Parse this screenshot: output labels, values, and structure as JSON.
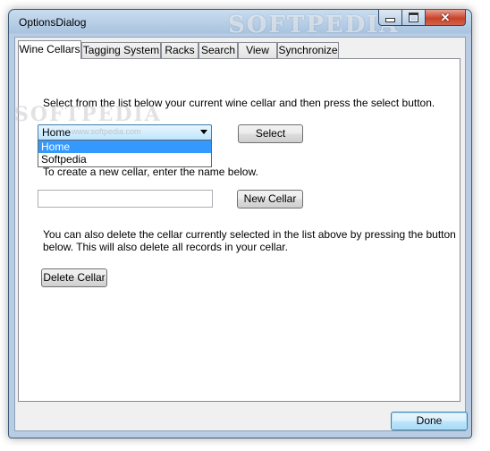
{
  "window": {
    "title": "OptionsDialog",
    "watermark": "SOFTPEDIA",
    "watermark_url": "www.softpedia.com"
  },
  "tabs": [
    {
      "label": "Wine Cellars",
      "active": true
    },
    {
      "label": "Tagging System",
      "active": false
    },
    {
      "label": "Racks",
      "active": false
    },
    {
      "label": "Search",
      "active": false
    },
    {
      "label": "View",
      "active": false
    },
    {
      "label": "Synchronize",
      "active": false
    }
  ],
  "wine_cellars": {
    "select_instruction": "Select from the list below your current wine cellar and then press the select button.",
    "cellar_combo_value": "Home",
    "cellar_options": [
      "Home",
      "Softpedia"
    ],
    "select_button": "Select",
    "create_instruction": "To create a new cellar, enter the name below.",
    "new_cellar_name_value": "",
    "new_cellar_button": "New Cellar",
    "delete_instruction_line1": "You can also delete the cellar currently selected in the list above by pressing the button",
    "delete_instruction_line2": "below. This will also delete all records in your cellar.",
    "delete_button": "Delete Cellar"
  },
  "footer": {
    "done_button": "Done"
  },
  "icons": {
    "minimize": "minimize-icon",
    "maximize": "maximize-icon",
    "close": "close-icon",
    "dropdown": "chevron-down-icon"
  }
}
